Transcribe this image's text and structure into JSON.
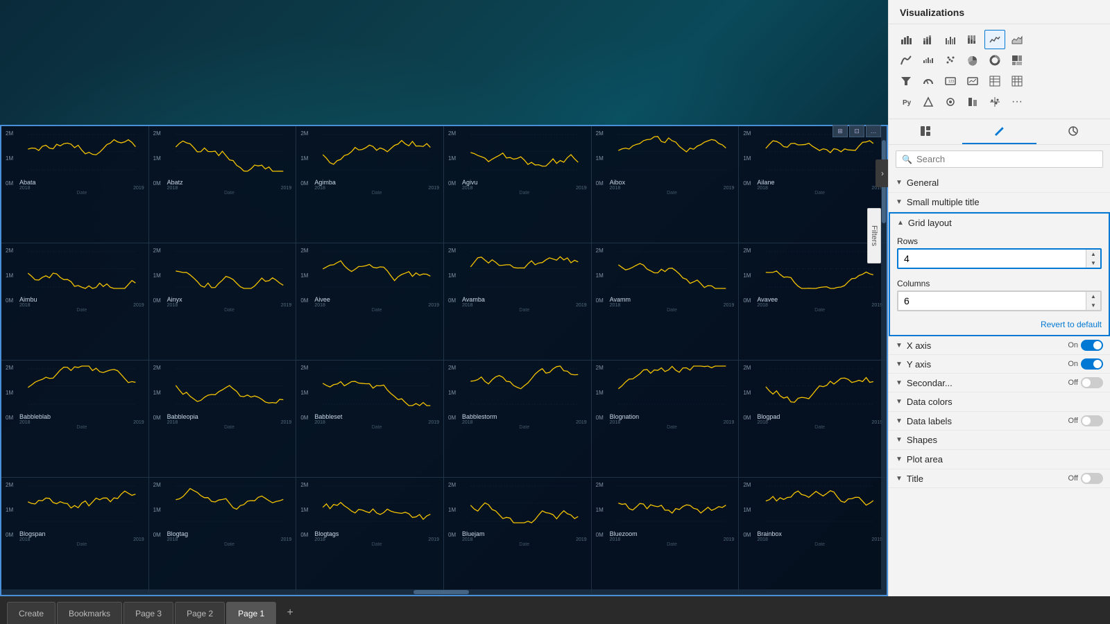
{
  "header": {
    "title": "Visualizations"
  },
  "right_panel": {
    "visualizations_title": "Visualizations",
    "search_placeholder": "Search",
    "search_value": "",
    "sections": [
      {
        "id": "general",
        "label": "General",
        "expanded": false
      },
      {
        "id": "small_multiple_title",
        "label": "Small multiple title",
        "expanded": false
      },
      {
        "id": "grid_layout",
        "label": "Grid layout",
        "expanded": true,
        "active": true
      },
      {
        "id": "x_axis",
        "label": "X axis",
        "expanded": false,
        "toggle": "On",
        "toggle_on": true
      },
      {
        "id": "y_axis",
        "label": "Y axis",
        "expanded": false,
        "toggle": "On",
        "toggle_on": true
      },
      {
        "id": "secondary",
        "label": "Secondar...",
        "expanded": false,
        "toggle": "Off",
        "toggle_on": false
      },
      {
        "id": "data_colors",
        "label": "Data colors",
        "expanded": false
      },
      {
        "id": "data_labels",
        "label": "Data labels",
        "expanded": false,
        "toggle": "Off",
        "toggle_on": false
      },
      {
        "id": "shapes",
        "label": "Shapes",
        "expanded": false
      },
      {
        "id": "plot_area",
        "label": "Plot area",
        "expanded": false
      },
      {
        "id": "title",
        "label": "Title",
        "expanded": false,
        "toggle": "Off",
        "toggle_on": false
      }
    ],
    "grid_layout": {
      "rows_label": "Rows",
      "rows_value": "4",
      "columns_label": "Columns",
      "columns_value": "6",
      "revert_label": "Revert to default"
    }
  },
  "charts": [
    {
      "title": "Abata",
      "row": 0,
      "col": 0
    },
    {
      "title": "Abatz",
      "row": 0,
      "col": 1
    },
    {
      "title": "Agimba",
      "row": 0,
      "col": 2
    },
    {
      "title": "Agivu",
      "row": 0,
      "col": 3
    },
    {
      "title": "Aibox",
      "row": 0,
      "col": 4
    },
    {
      "title": "Ailane",
      "row": 0,
      "col": 5
    },
    {
      "title": "Aimbu",
      "row": 1,
      "col": 0
    },
    {
      "title": "Ainyx",
      "row": 1,
      "col": 1
    },
    {
      "title": "Aivee",
      "row": 1,
      "col": 2
    },
    {
      "title": "Avamba",
      "row": 1,
      "col": 3
    },
    {
      "title": "Avamm",
      "row": 1,
      "col": 4
    },
    {
      "title": "Avavee",
      "row": 1,
      "col": 5
    },
    {
      "title": "Babbleblab",
      "row": 2,
      "col": 0
    },
    {
      "title": "Babbleopia",
      "row": 2,
      "col": 1
    },
    {
      "title": "Babbleset",
      "row": 2,
      "col": 2
    },
    {
      "title": "Babblestorm",
      "row": 2,
      "col": 3
    },
    {
      "title": "Blognation",
      "row": 2,
      "col": 4
    },
    {
      "title": "Blogpad",
      "row": 2,
      "col": 5
    },
    {
      "title": "Blogspan",
      "row": 3,
      "col": 0
    },
    {
      "title": "Blogtag",
      "row": 3,
      "col": 1
    },
    {
      "title": "Blogtags",
      "row": 3,
      "col": 2
    },
    {
      "title": "Bluejam",
      "row": 3,
      "col": 3
    },
    {
      "title": "Bluezoom",
      "row": 3,
      "col": 4
    },
    {
      "title": "Brainbox",
      "row": 3,
      "col": 5
    }
  ],
  "bottom_tabs": [
    {
      "id": "create",
      "label": "Create",
      "active": false
    },
    {
      "id": "bookmarks",
      "label": "Bookmarks",
      "active": false
    },
    {
      "id": "page3",
      "label": "Page 3",
      "active": false
    },
    {
      "id": "page2",
      "label": "Page 2",
      "active": false
    },
    {
      "id": "page1",
      "label": "Page 1",
      "active": true
    }
  ],
  "filters_label": "Filters",
  "y_axis_labels": [
    "2M",
    "1M",
    "0M"
  ],
  "x_axis_labels": [
    "2018",
    "2019"
  ],
  "x_axis_title": "Date",
  "viz_icons": {
    "row1": [
      "bar-chart",
      "stacked-bar",
      "grouped-bar",
      "100-bar",
      "line-chart",
      "area-chart"
    ],
    "row2": [
      "ribbon",
      "waterfall",
      "scatter",
      "pie",
      "donut",
      "treemap"
    ],
    "row3": [
      "funnel",
      "gauge",
      "card",
      "kpi",
      "table",
      "matrix"
    ],
    "row4": [
      "r-visual",
      "custom1",
      "custom2",
      "custom3",
      "custom4",
      "more"
    ]
  },
  "viz_tab_icons": {
    "format": "format-icon",
    "fields": "fields-icon",
    "analytics": "analytics-icon"
  },
  "colors": {
    "accent": "#0078d4",
    "chart_line": "#f5c400",
    "chart_bg": "#050f1e",
    "panel_bg": "#f3f3f3",
    "toggle_on": "#0078d4",
    "toggle_off": "#cccccc"
  }
}
